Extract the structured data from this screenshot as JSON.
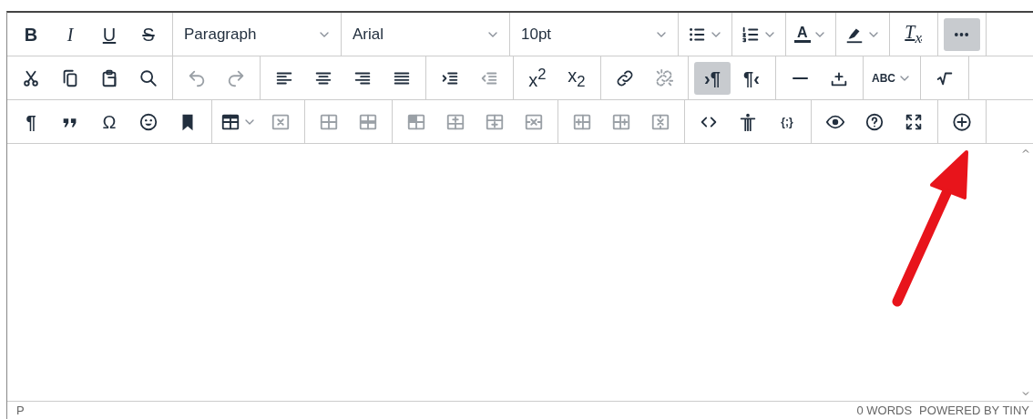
{
  "toolbar_rows": [
    {
      "groups": [
        {
          "items": [
            {
              "kind": "bold",
              "label": "B",
              "active": false,
              "disabled": false
            },
            {
              "kind": "italic",
              "label": "I",
              "active": false,
              "disabled": false
            },
            {
              "kind": "underline",
              "label": "U",
              "active": false,
              "disabled": false
            },
            {
              "kind": "strike",
              "label": "S",
              "active": false,
              "disabled": false
            }
          ]
        },
        {
          "items": [
            {
              "kind": "select",
              "label": "Paragraph"
            }
          ]
        },
        {
          "items": [
            {
              "kind": "select",
              "label": "Arial"
            }
          ]
        },
        {
          "items": [
            {
              "kind": "select",
              "label": "10pt"
            }
          ]
        },
        {
          "items": [
            {
              "kind": "split",
              "active": false,
              "disabled": false
            }
          ]
        },
        {
          "items": [
            {
              "kind": "split",
              "active": false,
              "disabled": false
            }
          ]
        },
        {
          "items": [
            {
              "kind": "colorsplit",
              "label": "A",
              "active": false,
              "disabled": false
            }
          ]
        },
        {
          "items": [
            {
              "kind": "split",
              "active": false,
              "disabled": false
            }
          ]
        },
        {
          "items": [
            {
              "kind": "clearformat",
              "label": "T$_{x}$",
              "active": false,
              "disabled": false
            }
          ]
        },
        {
          "items": [
            {
              "kind": "icon",
              "active": true,
              "disabled": false
            }
          ]
        }
      ]
    },
    {
      "groups": [
        {
          "items": [
            {
              "kind": "icon",
              "active": false,
              "disabled": false
            },
            {
              "kind": "icon",
              "active": false,
              "disabled": false
            },
            {
              "kind": "icon",
              "active": false,
              "disabled": false
            },
            {
              "kind": "icon",
              "active": false,
              "disabled": false
            }
          ]
        },
        {
          "items": [
            {
              "kind": "icon",
              "active": false,
              "disabled": true
            },
            {
              "kind": "icon",
              "active": false,
              "disabled": true
            }
          ]
        },
        {
          "items": [
            {
              "kind": "icon",
              "active": false,
              "disabled": false
            },
            {
              "kind": "icon",
              "active": false,
              "disabled": false
            },
            {
              "kind": "icon",
              "active": false,
              "disabled": false
            },
            {
              "kind": "icon",
              "active": false,
              "disabled": false
            }
          ]
        },
        {
          "items": [
            {
              "kind": "icon",
              "active": false,
              "disabled": false
            },
            {
              "kind": "icon",
              "active": false,
              "disabled": true
            }
          ]
        },
        {
          "items": [
            {
              "kind": "plain",
              "label": "x$^{2}$",
              "active": false,
              "disabled": false
            },
            {
              "kind": "plain",
              "label": "x$_{2}$",
              "active": false,
              "disabled": false
            }
          ]
        },
        {
          "items": [
            {
              "kind": "icon",
              "active": false,
              "disabled": false
            },
            {
              "kind": "icon",
              "active": false,
              "disabled": true
            }
          ]
        },
        {
          "items": [
            {
              "kind": "bold",
              "label": "›¶",
              "active": true,
              "disabled": false
            },
            {
              "kind": "bold",
              "label": "¶‹",
              "active": false,
              "disabled": false
            }
          ]
        },
        {
          "items": [
            {
              "kind": "icon",
              "active": false,
              "disabled": false
            },
            {
              "kind": "icon",
              "active": false,
              "disabled": false
            }
          ]
        },
        {
          "items": [
            {
              "kind": "smallsplit",
              "label": "ABC",
              "active": false,
              "disabled": false
            }
          ]
        },
        {
          "items": [
            {
              "kind": "icon",
              "active": false,
              "disabled": false
            }
          ]
        }
      ]
    },
    {
      "groups": [
        {
          "items": [
            {
              "kind": "bold",
              "label": "¶",
              "active": false,
              "disabled": false
            },
            {
              "kind": "icon",
              "active": false,
              "disabled": false
            },
            {
              "kind": "plain",
              "label": "Ω",
              "active": false,
              "disabled": false
            },
            {
              "kind": "icon",
              "active": false,
              "disabled": false
            },
            {
              "kind": "icon",
              "active": false,
              "disabled": false
            }
          ]
        },
        {
          "items": [
            {
              "kind": "split",
              "active": false,
              "disabled": false
            },
            {
              "kind": "icon",
              "active": false,
              "disabled": true
            }
          ]
        },
        {
          "items": [
            {
              "kind": "icon",
              "active": false,
              "disabled": true
            },
            {
              "kind": "icon",
              "active": false,
              "disabled": true
            }
          ]
        },
        {
          "items": [
            {
              "kind": "icon",
              "active": false,
              "disabled": true
            },
            {
              "kind": "icon",
              "active": false,
              "disabled": true
            },
            {
              "kind": "icon",
              "active": false,
              "disabled": true
            },
            {
              "kind": "icon",
              "active": false,
              "disabled": true
            }
          ]
        },
        {
          "items": [
            {
              "kind": "icon",
              "active": false,
              "disabled": true
            },
            {
              "kind": "icon",
              "active": false,
              "disabled": true
            },
            {
              "kind": "icon",
              "active": false,
              "disabled": true
            }
          ]
        },
        {
          "items": [
            {
              "kind": "icon",
              "active": false,
              "disabled": false
            },
            {
              "kind": "icon",
              "active": false,
              "disabled": false
            },
            {
              "kind": "small",
              "label": "{;}",
              "active": false,
              "disabled": false
            }
          ]
        },
        {
          "items": [
            {
              "kind": "icon",
              "active": false,
              "disabled": false
            },
            {
              "kind": "icon",
              "active": false,
              "disabled": false
            },
            {
              "kind": "icon",
              "active": false,
              "disabled": false
            }
          ]
        },
        {
          "items": [
            {
              "kind": "icon",
              "active": false,
              "disabled": false
            }
          ]
        }
      ]
    }
  ],
  "status_bar": {
    "path": "P",
    "word_count": "0 WORDS",
    "branding": "POWERED BY TINY"
  }
}
